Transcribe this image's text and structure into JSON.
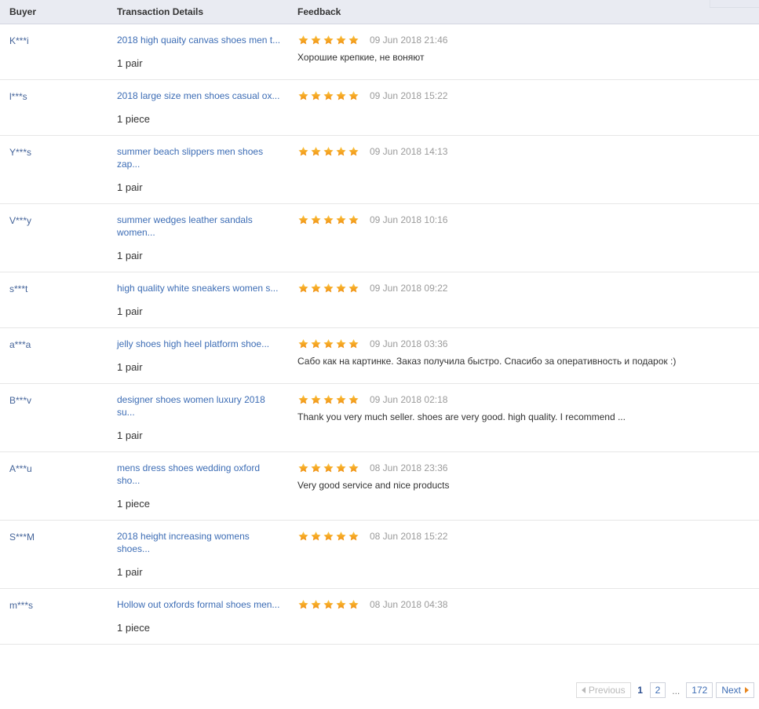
{
  "table": {
    "columns": [
      {
        "key": "buyer",
        "label": "Buyer"
      },
      {
        "key": "transaction",
        "label": "Transaction Details"
      },
      {
        "key": "feedback",
        "label": "Feedback"
      }
    ],
    "rows": [
      {
        "buyer": "K***i",
        "product": "2018 high quaity canvas shoes men t...",
        "quantity": "1 pair",
        "rating": 5,
        "date": "09 Jun 2018 21:46",
        "comment": "Хорошие крепкие, не воняют"
      },
      {
        "buyer": "l***s",
        "product": "2018 large size men shoes casual ox...",
        "quantity": "1 piece",
        "rating": 5,
        "date": "09 Jun 2018 15:22",
        "comment": ""
      },
      {
        "buyer": "Y***s",
        "product": "summer beach slippers men shoes zap...",
        "quantity": "1 pair",
        "rating": 5,
        "date": "09 Jun 2018 14:13",
        "comment": ""
      },
      {
        "buyer": "V***y",
        "product": "summer wedges leather sandals women...",
        "quantity": "1 pair",
        "rating": 5,
        "date": "09 Jun 2018 10:16",
        "comment": ""
      },
      {
        "buyer": "s***t",
        "product": "high quality white sneakers women s...",
        "quantity": "1 pair",
        "rating": 5,
        "date": "09 Jun 2018 09:22",
        "comment": ""
      },
      {
        "buyer": "a***a",
        "product": "jelly shoes high heel platform shoe...",
        "quantity": "1 pair",
        "rating": 5,
        "date": "09 Jun 2018 03:36",
        "comment": "Сабо как на картинке. Заказ получила быстро. Спасибо за оперативность и подарок :)"
      },
      {
        "buyer": "B***v",
        "product": "designer shoes women luxury 2018 su...",
        "quantity": "1 pair",
        "rating": 5,
        "date": "09 Jun 2018 02:18",
        "comment": "Thank you very much seller. shoes are very good. high quality. I recommend ..."
      },
      {
        "buyer": "A***u",
        "product": "mens dress shoes wedding oxford sho...",
        "quantity": "1 piece",
        "rating": 5,
        "date": "08 Jun 2018 23:36",
        "comment": "Very good service and nice products"
      },
      {
        "buyer": "S***M",
        "product": "2018 height increasing womens shoes...",
        "quantity": "1 pair",
        "rating": 5,
        "date": "08 Jun 2018 15:22",
        "comment": ""
      },
      {
        "buyer": "m***s",
        "product": "Hollow out oxfords formal shoes men...",
        "quantity": "1 piece",
        "rating": 5,
        "date": "08 Jun 2018 04:38",
        "comment": ""
      }
    ]
  },
  "pagination": {
    "previous_label": "Previous",
    "next_label": "Next",
    "current_page": "1",
    "pages": [
      "2"
    ],
    "ellipsis": "...",
    "last_page": "172"
  },
  "colors": {
    "header_bg": "#e9ebf2",
    "link": "#3d6db5",
    "star": "#f5a623",
    "date": "#9b9b9b",
    "row_border": "#e6e6e6"
  }
}
